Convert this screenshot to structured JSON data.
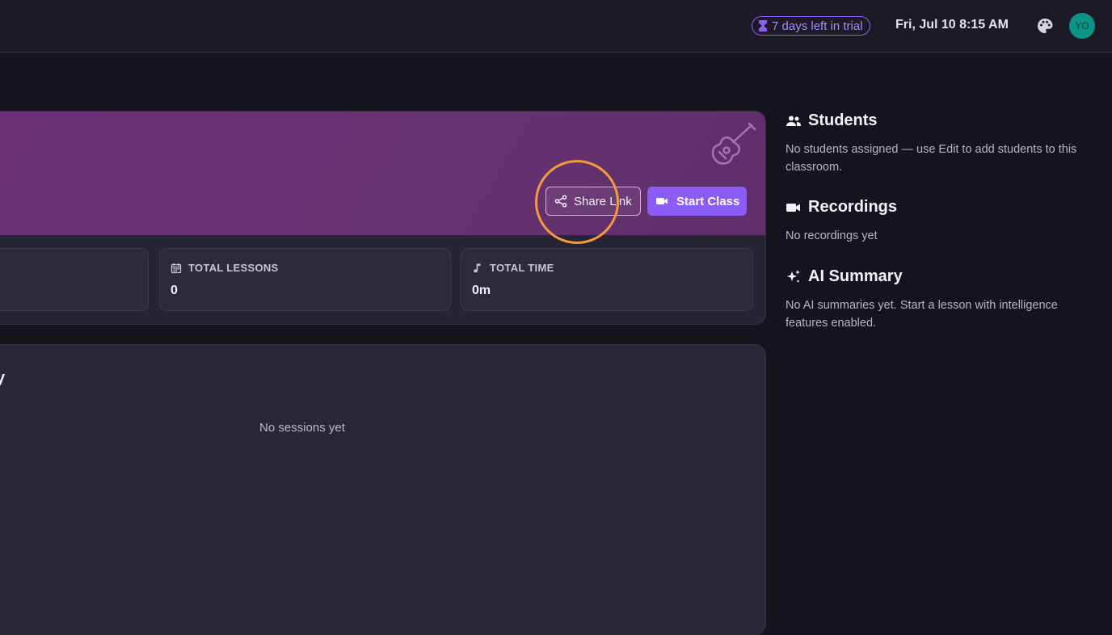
{
  "topbar": {
    "trial_label": "7 days left in trial",
    "datetime": "Fri, Jul 10 8:15 AM",
    "avatar_initials": "YO"
  },
  "hero": {
    "share_label": "Share Link",
    "start_label": "Start Class",
    "banner_icon": "guitar-icon"
  },
  "stats": [
    {
      "label": "",
      "value": ""
    },
    {
      "label": "TOTAL LESSONS",
      "value": "0",
      "icon": "calendar-icon"
    },
    {
      "label": "TOTAL TIME",
      "value": "0m",
      "icon": "music-note-icon"
    }
  ],
  "sessions": {
    "title_fragment": "y",
    "empty_text": "No sessions yet"
  },
  "sidebar": {
    "students": {
      "title": "Students",
      "text": "No students assigned — use Edit to add students to this classroom."
    },
    "recordings": {
      "title": "Recordings",
      "text": "No recordings yet"
    },
    "ai_summary": {
      "title": "AI Summary",
      "text": "No AI summaries yet. Start a lesson with intelligence features enabled."
    }
  },
  "colors": {
    "accent": "#8b5cf6",
    "banner": "#6b2f78",
    "avatar": "#0d9488",
    "highlight_ring": "#f59a3c"
  }
}
